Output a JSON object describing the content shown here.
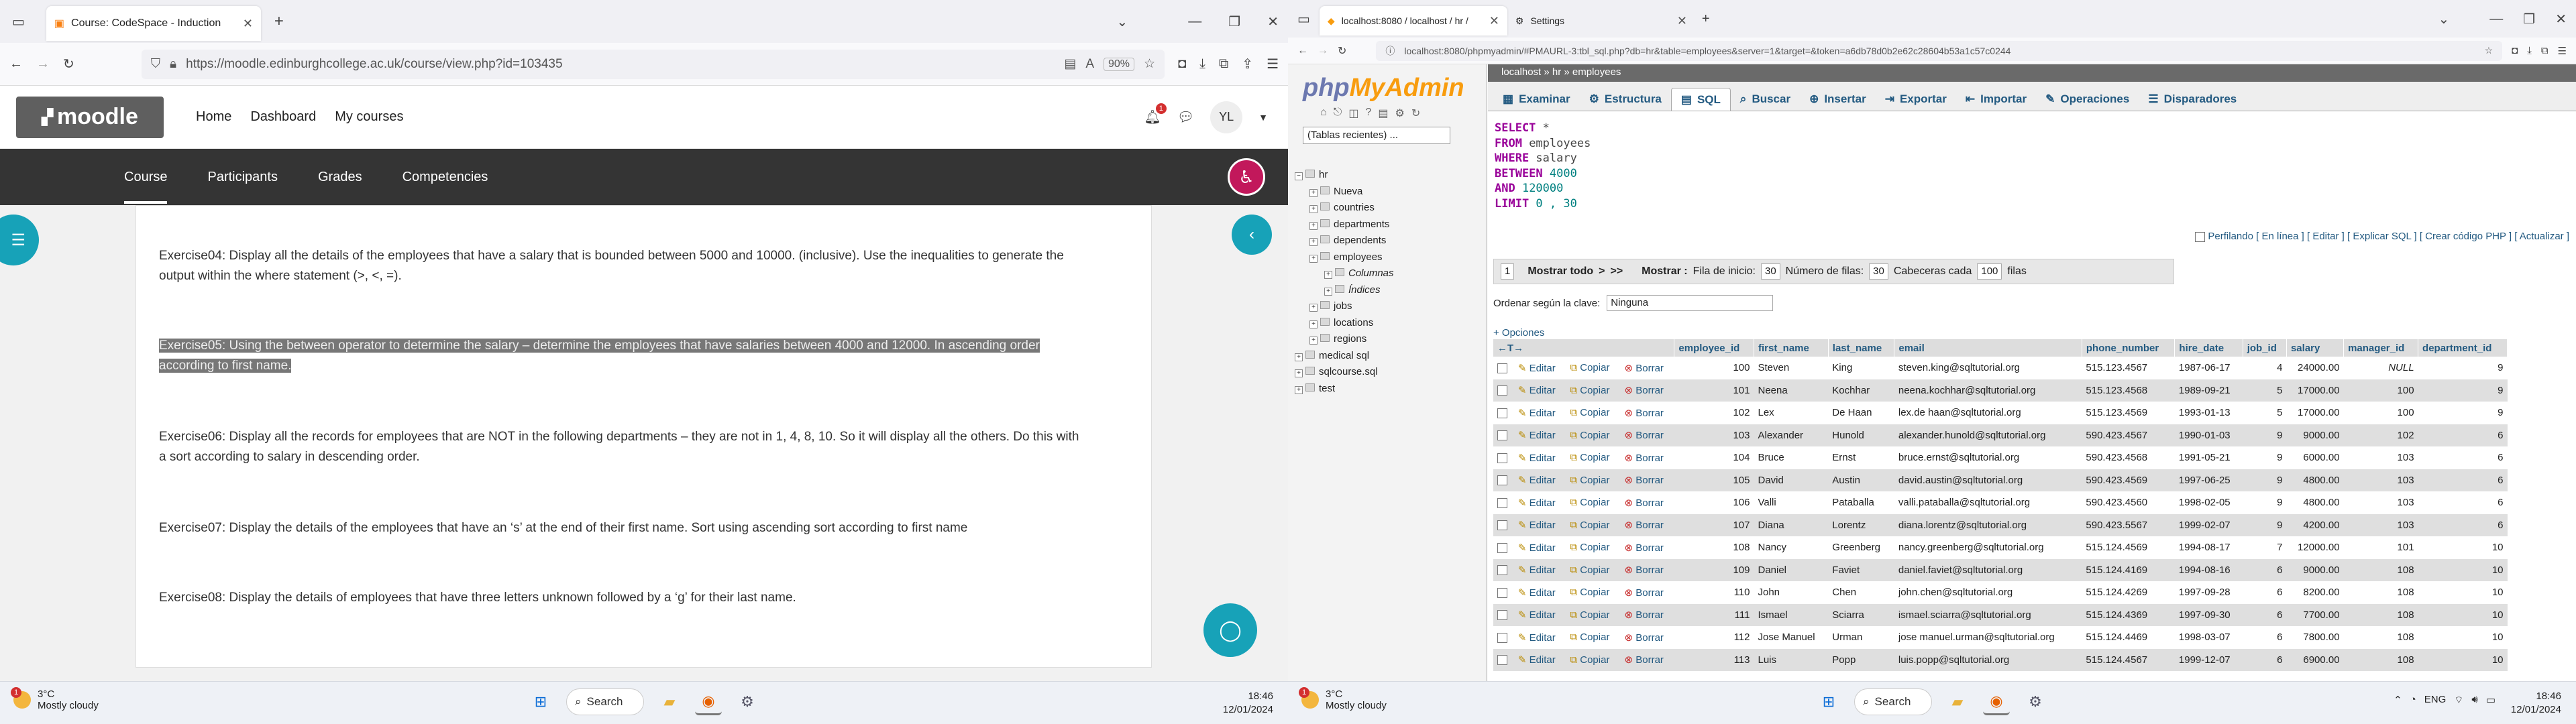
{
  "left_window": {
    "tab_title": "Course: CodeSpace - Induction",
    "url": "https://moodle.edinburghcollege.ac.uk/course/view.php?id=103435",
    "zoom": "90%",
    "nav": {
      "home": "Home",
      "dashboard": "Dashboard",
      "my_courses": "My courses"
    },
    "notification_count": "1",
    "avatar": "YL",
    "secondary_nav": [
      "Course",
      "Participants",
      "Grades",
      "Competencies"
    ],
    "exercises": [
      "Exercise04: Display all the details of the employees that have a salary that is bounded between 5000 and 10000. (inclusive). Use the inequalities to generate the output within the where statement (>, <, =).",
      "Exercise05: Using the between operator to determine the salary – determine the employees that have salaries between 4000 and 12000. In ascending order according to first name.",
      "Exercise06: Display all the records for employees that are NOT in the following departments – they are not in 1, 4, 8, 10. So it will display all the others. Do this with a sort according to salary in descending order.",
      "Exercise07: Display the details of the employees that have an ‘s’ at the end of their first name. Sort using ascending sort according to first name",
      "Exercise08: Display the details of employees that have three letters unknown followed by a ‘g’  for their last name."
    ],
    "taskbar": {
      "temp": "3°C",
      "weather": "Mostly cloudy",
      "badge": "1",
      "search": "Search",
      "time": "18:46",
      "date": "12/01/2024"
    }
  },
  "right_window": {
    "tabs": [
      "localhost:8080 / localhost / hr /",
      "Settings"
    ],
    "url": "localhost:8080/phpmyadmin/#PMAURL-3:tbl_sql.php?db=hr&table=employees&server=1&target=&token=a6db78d0b2e62c28604b53a1c57c0244",
    "logo_a": "php",
    "logo_b": "MyAdmin",
    "recent": "(Tablas recientes) ...",
    "breadcrumb": "localhost » hr » employees",
    "tree": [
      {
        "name": "hr",
        "level": 0
      },
      {
        "name": "Nueva",
        "level": 1
      },
      {
        "name": "countries",
        "level": 1
      },
      {
        "name": "departments",
        "level": 1
      },
      {
        "name": "dependents",
        "level": 1
      },
      {
        "name": "employees",
        "level": 1
      },
      {
        "name": "Columnas",
        "level": 2
      },
      {
        "name": "Índices",
        "level": 2
      },
      {
        "name": "jobs",
        "level": 1
      },
      {
        "name": "locations",
        "level": 1
      },
      {
        "name": "regions",
        "level": 1
      },
      {
        "name": "medical sql",
        "level": 0
      },
      {
        "name": "sqlcourse.sql",
        "level": 0
      },
      {
        "name": "test",
        "level": 0
      }
    ],
    "tabs_pma": [
      "Examinar",
      "Estructura",
      "SQL",
      "Buscar",
      "Insertar",
      "Exportar",
      "Importar",
      "Operaciones",
      "Disparadores"
    ],
    "sql": [
      {
        "kw": "SELECT",
        "rest": " *"
      },
      {
        "kw": "FROM",
        "rest": " employees"
      },
      {
        "kw": "WHERE",
        "rest": " salary"
      },
      {
        "kw": "BETWEEN",
        "rest": " 4000"
      },
      {
        "kw": "AND",
        "rest": " 120000"
      },
      {
        "kw": "LIMIT",
        "rest": " 0 , 30"
      }
    ],
    "ops_line": "Perfilando [ En línea ] [ Editar ] [ Explicar SQL ] [ Crear código PHP ] [ Actualizar ]",
    "nav": {
      "page": "1",
      "show_all": "Mostrar todo",
      "show": "Mostrar :",
      "start_label": "Fila de inicio:",
      "start": "30",
      "rows_label": "Número de filas:",
      "rows": "30",
      "header_label": "Cabeceras cada",
      "header": "100",
      "filas": "filas"
    },
    "sort_label": "Ordenar según la clave:",
    "sort_value": "Ninguna",
    "opciones": "+ Opciones",
    "actions": {
      "edit": "Editar",
      "copy": "Copiar",
      "delete": "Borrar"
    },
    "columns": [
      "employee_id",
      "first_name",
      "last_name",
      "email",
      "phone_number",
      "hire_date",
      "job_id",
      "salary",
      "manager_id",
      "department_id"
    ],
    "rows": [
      [
        "100",
        "Steven",
        "King",
        "steven.king@sqltutorial.org",
        "515.123.4567",
        "1987-06-17",
        "4",
        "24000.00",
        "NULL",
        "9"
      ],
      [
        "101",
        "Neena",
        "Kochhar",
        "neena.kochhar@sqltutorial.org",
        "515.123.4568",
        "1989-09-21",
        "5",
        "17000.00",
        "100",
        "9"
      ],
      [
        "102",
        "Lex",
        "De Haan",
        "lex.de haan@sqltutorial.org",
        "515.123.4569",
        "1993-01-13",
        "5",
        "17000.00",
        "100",
        "9"
      ],
      [
        "103",
        "Alexander",
        "Hunold",
        "alexander.hunold@sqltutorial.org",
        "590.423.4567",
        "1990-01-03",
        "9",
        "9000.00",
        "102",
        "6"
      ],
      [
        "104",
        "Bruce",
        "Ernst",
        "bruce.ernst@sqltutorial.org",
        "590.423.4568",
        "1991-05-21",
        "9",
        "6000.00",
        "103",
        "6"
      ],
      [
        "105",
        "David",
        "Austin",
        "david.austin@sqltutorial.org",
        "590.423.4569",
        "1997-06-25",
        "9",
        "4800.00",
        "103",
        "6"
      ],
      [
        "106",
        "Valli",
        "Pataballa",
        "valli.pataballa@sqltutorial.org",
        "590.423.4560",
        "1998-02-05",
        "9",
        "4800.00",
        "103",
        "6"
      ],
      [
        "107",
        "Diana",
        "Lorentz",
        "diana.lorentz@sqltutorial.org",
        "590.423.5567",
        "1999-02-07",
        "9",
        "4200.00",
        "103",
        "6"
      ],
      [
        "108",
        "Nancy",
        "Greenberg",
        "nancy.greenberg@sqltutorial.org",
        "515.124.4569",
        "1994-08-17",
        "7",
        "12000.00",
        "101",
        "10"
      ],
      [
        "109",
        "Daniel",
        "Faviet",
        "daniel.faviet@sqltutorial.org",
        "515.124.4169",
        "1994-08-16",
        "6",
        "9000.00",
        "108",
        "10"
      ],
      [
        "110",
        "John",
        "Chen",
        "john.chen@sqltutorial.org",
        "515.124.4269",
        "1997-09-28",
        "6",
        "8200.00",
        "108",
        "10"
      ],
      [
        "111",
        "Ismael",
        "Sciarra",
        "ismael.sciarra@sqltutorial.org",
        "515.124.4369",
        "1997-09-30",
        "6",
        "7700.00",
        "108",
        "10"
      ],
      [
        "112",
        "Jose Manuel",
        "Urman",
        "jose manuel.urman@sqltutorial.org",
        "515.124.4469",
        "1998-03-07",
        "6",
        "7800.00",
        "108",
        "10"
      ],
      [
        "113",
        "Luis",
        "Popp",
        "luis.popp@sqltutorial.org",
        "515.124.4567",
        "1999-12-07",
        "6",
        "6900.00",
        "108",
        "10"
      ]
    ],
    "taskbar": {
      "temp": "3°C",
      "weather": "Mostly cloudy",
      "badge": "1",
      "search": "Search",
      "lang": "ENG",
      "time": "18:46",
      "date": "12/01/2024"
    }
  }
}
